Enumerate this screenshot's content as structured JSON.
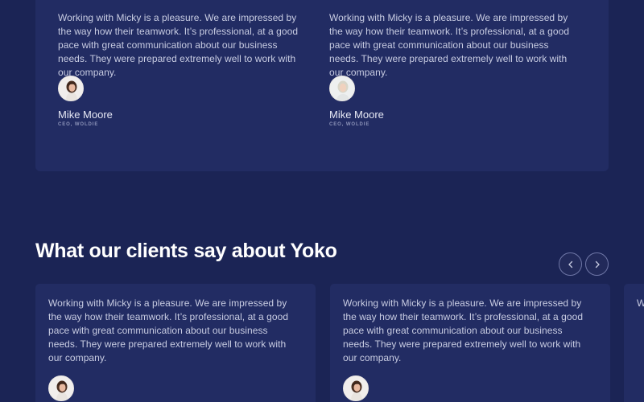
{
  "top_testimonials": [
    {
      "quote": "Working with Micky is a pleasure. We are impressed by the way how their teamwork. It’s professional, at a good pace with great communication about our business needs. They were prepared extremely well to work with our company.",
      "name": "Mike Moore",
      "role": "CEO, WOLDIE"
    },
    {
      "quote": "Working with Micky is a pleasure. We are impressed by the way how their teamwork. It’s professional, at a good pace with great communication about our business needs. They were prepared extremely well to work with our company.",
      "name": "Mike Moore",
      "role": "CEO, WOLDIE"
    }
  ],
  "section": {
    "heading_pre": "What ",
    "heading_highlight": "our clients",
    "heading_post": " say about Yoko",
    "prev_icon": "chevron-left-icon",
    "next_icon": "chevron-right-icon"
  },
  "bottom_testimonials": [
    {
      "quote": "Working with Micky is a pleasure. We are impressed by the way how their teamwork. It’s professional, at a good pace with great communication about our business needs. They were prepared extremely well to work with our company."
    },
    {
      "quote": "Working with Micky is a pleasure. We are impressed by the way how their teamwork. It’s professional, at a good pace with great communication about our business needs. They were prepared extremely well to work with our company."
    },
    {
      "quote": "W ... ... ..."
    }
  ],
  "colors": {
    "background": "#1b2455",
    "card": "#222c63",
    "highlight": "#3a6fd8"
  }
}
